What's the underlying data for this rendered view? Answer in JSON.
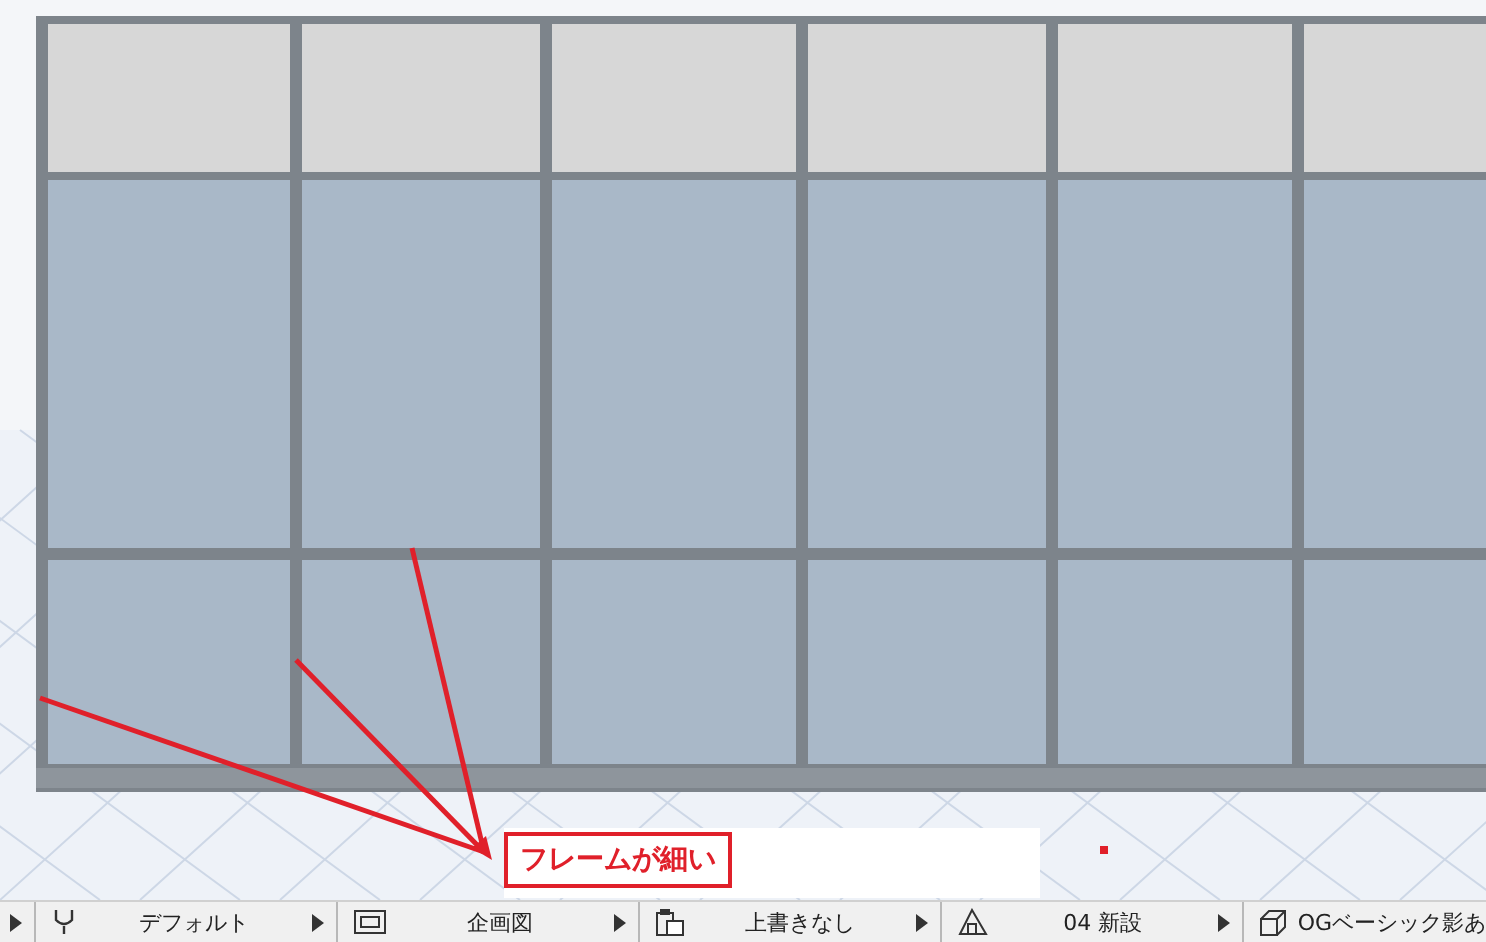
{
  "annotation": {
    "label": "フレームが細い"
  },
  "status_bar": {
    "items": [
      {
        "label": "デフォルト"
      },
      {
        "label": "企画図"
      },
      {
        "label": "上書きなし"
      },
      {
        "label": "04 新設"
      },
      {
        "label": "OGベーシック影あ"
      }
    ]
  }
}
